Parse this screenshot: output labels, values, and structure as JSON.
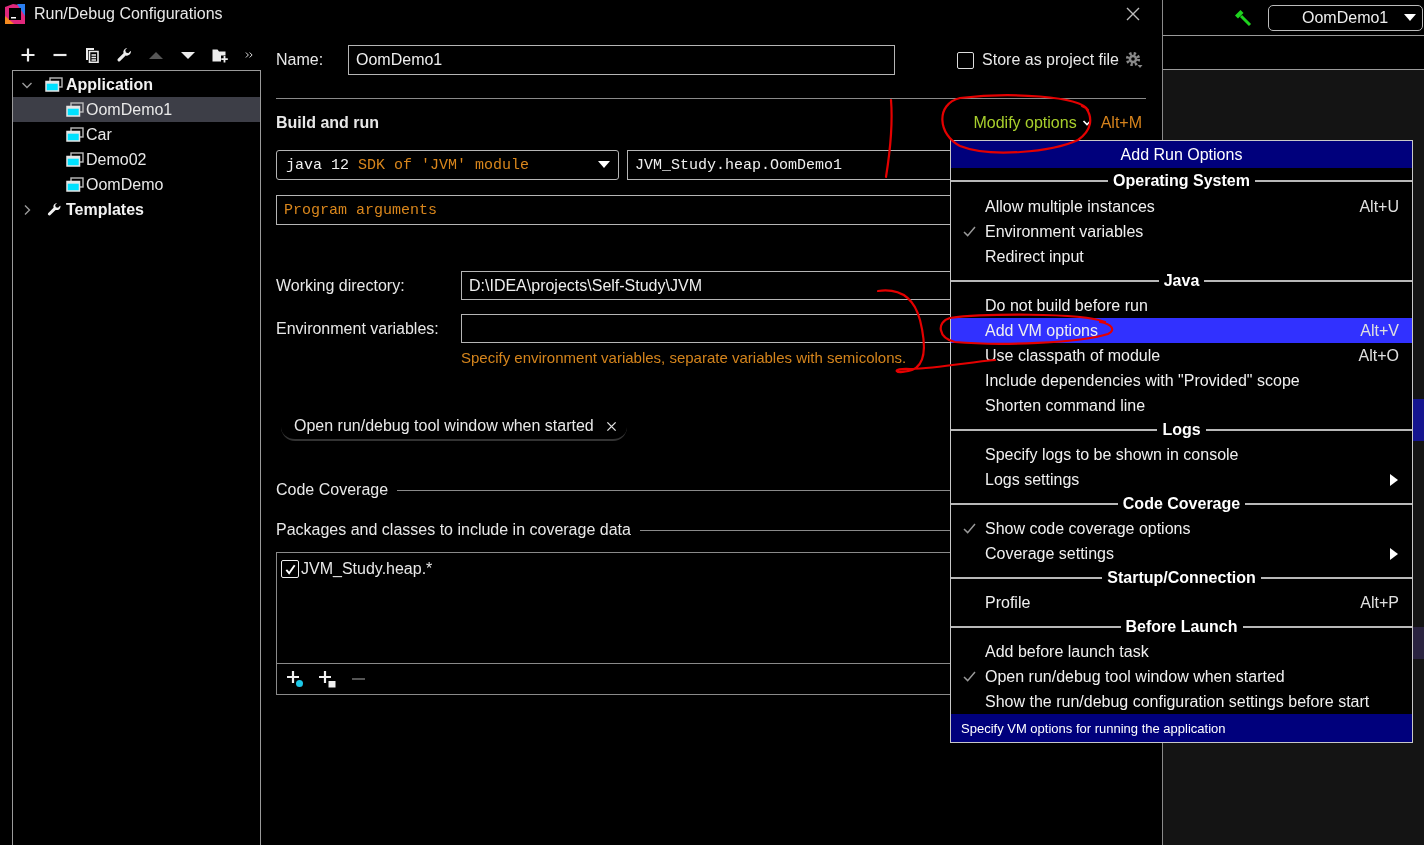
{
  "window": {
    "title": "Run/Debug Configurations"
  },
  "toolbar": [
    {
      "kind": "add",
      "disabled": false
    },
    {
      "kind": "remove",
      "disabled": false
    },
    {
      "kind": "copy",
      "disabled": false
    },
    {
      "kind": "wrench",
      "disabled": false
    },
    {
      "kind": "move-up",
      "disabled": true
    },
    {
      "kind": "move-down",
      "disabled": false
    },
    {
      "kind": "new-folder",
      "disabled": false
    },
    {
      "kind": "more",
      "disabled": false
    }
  ],
  "tree": [
    {
      "label": "Application",
      "kind": "application",
      "expanded": true,
      "selected": false,
      "children": [
        {
          "label": "OomDemo1",
          "kind": "application",
          "selected": true
        },
        {
          "label": "Car",
          "kind": "application",
          "selected": false
        },
        {
          "label": "Demo02",
          "kind": "application",
          "selected": false
        },
        {
          "label": "OomDemo",
          "kind": "application",
          "selected": false
        }
      ]
    },
    {
      "label": "Templates",
      "kind": "templates",
      "expanded": false,
      "selected": false
    }
  ],
  "form": {
    "name": {
      "label": "Name:",
      "value": "OomDemo1"
    },
    "store_as_project_file": {
      "label": "Store as project file",
      "checked": false
    },
    "build_and_run": {
      "title": "Build and run",
      "modify_options": {
        "label": "Modify options",
        "shortcut": "Alt+M"
      },
      "jre": {
        "value": "java 12",
        "hint": "SDK of 'JVM' module"
      },
      "main_class": {
        "value": "JVM_Study.heap.OomDemo1"
      },
      "program_arguments": {
        "placeholder": "Program arguments"
      }
    },
    "working_directory": {
      "label": "Working directory:",
      "value": "D:\\IDEA\\projects\\Self-Study\\JVM"
    },
    "environment_variables": {
      "label": "Environment variables:",
      "hint": "Specify environment variables, separate variables with semicolons."
    },
    "tags": [
      {
        "label": "Open run/debug tool window when started"
      }
    ],
    "code_coverage": {
      "title": "Code Coverage",
      "list_title": "Packages and classes to include in coverage data",
      "patterns": [
        {
          "label": "JVM_Study.heap.*",
          "checked": true
        }
      ],
      "toolbar": [
        {
          "kind": "add-class",
          "disabled": false
        },
        {
          "kind": "add-package",
          "disabled": false
        },
        {
          "kind": "remove",
          "disabled": true
        }
      ]
    }
  },
  "menu": {
    "title": "Add Run Options",
    "groups": [
      {
        "title": "Operating System",
        "items": [
          {
            "label": "Allow multiple instances",
            "shortcut": "Alt+U",
            "checked": false,
            "selected": false,
            "submenu": false
          },
          {
            "label": "Environment variables",
            "checked": true,
            "selected": false,
            "submenu": false
          },
          {
            "label": "Redirect input",
            "checked": false,
            "selected": false,
            "submenu": false
          }
        ]
      },
      {
        "title": "Java",
        "items": [
          {
            "label": "Do not build before run",
            "checked": false,
            "selected": false,
            "submenu": false
          },
          {
            "label": "Add VM options",
            "shortcut": "Alt+V",
            "checked": false,
            "selected": true,
            "submenu": false
          },
          {
            "label": "Use classpath of module",
            "shortcut": "Alt+O",
            "checked": false,
            "selected": false,
            "submenu": false
          },
          {
            "label": "Include dependencies with \"Provided\" scope",
            "checked": false,
            "selected": false,
            "submenu": false
          },
          {
            "label": "Shorten command line",
            "checked": false,
            "selected": false,
            "submenu": false
          }
        ]
      },
      {
        "title": "Logs",
        "items": [
          {
            "label": "Specify logs to be shown in console",
            "checked": false,
            "selected": false,
            "submenu": false
          },
          {
            "label": "Logs settings",
            "checked": false,
            "selected": false,
            "submenu": true
          }
        ]
      },
      {
        "title": "Code Coverage",
        "items": [
          {
            "label": "Show code coverage options",
            "checked": true,
            "selected": false,
            "submenu": false
          },
          {
            "label": "Coverage settings",
            "checked": false,
            "selected": false,
            "submenu": true
          }
        ]
      },
      {
        "title": "Startup/Connection",
        "items": [
          {
            "label": "Profile",
            "shortcut": "Alt+P",
            "checked": false,
            "selected": false,
            "submenu": false
          }
        ]
      },
      {
        "title": "Before Launch",
        "items": [
          {
            "label": "Add before launch task",
            "checked": false,
            "selected": false,
            "submenu": false
          },
          {
            "label": "Open run/debug tool window when started",
            "checked": true,
            "selected": false,
            "submenu": false
          },
          {
            "label": "Show the run/debug configuration settings before start",
            "checked": false,
            "selected": false,
            "submenu": false
          }
        ]
      }
    ],
    "footer": "Specify VM options for running the application"
  },
  "ide": {
    "run_configuration": "OomDemo1"
  }
}
